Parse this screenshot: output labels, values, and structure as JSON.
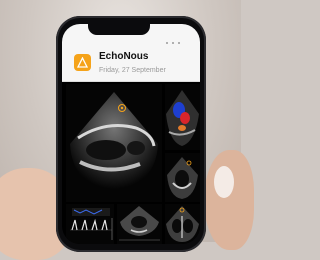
{
  "app": {
    "title": "EchoNous",
    "date": "Friday, 27 September",
    "icon": "echonous-logo-icon",
    "accent_color": "#f5a31a"
  },
  "images": [
    {
      "kind": "parasternal-long-axis-echo-image"
    },
    {
      "kind": "color-doppler-echo-image"
    },
    {
      "kind": "short-axis-echo-image"
    },
    {
      "kind": "doppler-waveform-image"
    },
    {
      "kind": "spectral-doppler-image"
    },
    {
      "kind": "apical-four-chamber-echo-image"
    }
  ]
}
